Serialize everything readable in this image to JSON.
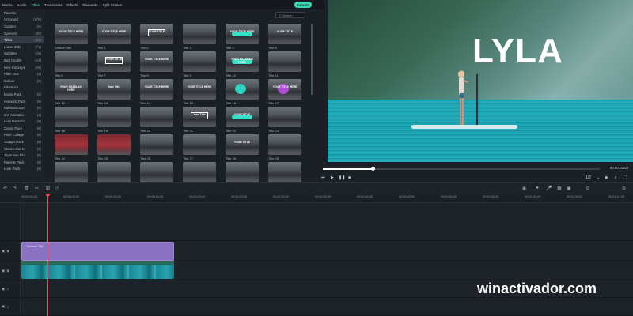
{
  "top_tabs": [
    "Media",
    "Audio",
    "Titles",
    "Transitions",
    "Effects",
    "Elements",
    "Split Screen"
  ],
  "export_label": "EXPORT",
  "search_placeholder": "Search",
  "categories": [
    {
      "label": "Favorite",
      "count": ""
    },
    {
      "label": "Unlocked",
      "count": "(176)"
    },
    {
      "label": "Custom",
      "count": "(0)"
    },
    {
      "label": "Openers",
      "count": "(30)"
    },
    {
      "label": "Titles",
      "count": "(43)"
    },
    {
      "label": "Lower 3rds",
      "count": "(71)"
    },
    {
      "label": "Subtitles",
      "count": "(15)"
    },
    {
      "label": "End Credits",
      "count": "(14)"
    },
    {
      "label": "New Concept",
      "count": "(28)"
    },
    {
      "label": "Plain Text",
      "count": "(4)"
    },
    {
      "label": "Callout",
      "count": "(8)"
    },
    {
      "label": "Filmstock",
      "count": ""
    },
    {
      "label": "Moxie Pack",
      "count": "(8)"
    },
    {
      "label": "Hypnotic Pack",
      "count": "(8)"
    },
    {
      "label": "Kaleidoscope",
      "count": "(9)"
    },
    {
      "label": "2nd Animatio",
      "count": "(4)"
    },
    {
      "label": "Hula Barmsho",
      "count": "(8)"
    },
    {
      "label": "Comic Pack",
      "count": "(8)"
    },
    {
      "label": "Pixel Collage",
      "count": "(8)"
    },
    {
      "label": "Gadget Pack",
      "count": "(8)"
    },
    {
      "label": "Sketch and C",
      "count": "(8)"
    },
    {
      "label": "Japanese Dra",
      "count": "(8)"
    },
    {
      "label": "Parents Pack",
      "count": "(8)"
    },
    {
      "label": "Love Pack",
      "count": "(8)"
    }
  ],
  "titles": [
    {
      "label": "Default Title",
      "caption": "YOUR TITLE HERE"
    },
    {
      "label": "Title 1",
      "caption": "YOUR TITLE HERE"
    },
    {
      "label": "Title 2",
      "caption": "YOUR TITLE"
    },
    {
      "label": "Title 3",
      "caption": ""
    },
    {
      "label": "Title 4",
      "caption": "YOUR TITLE HERE"
    },
    {
      "label": "Title 5",
      "caption": "YOUR TITLE"
    },
    {
      "label": "Title 6",
      "caption": ""
    },
    {
      "label": "Title 7",
      "caption": "YOUR TITLE"
    },
    {
      "label": "Title 8",
      "caption": "YOUR TITLE HERE"
    },
    {
      "label": "Title 9",
      "caption": ""
    },
    {
      "label": "Title 10",
      "caption": "YOUR HEADLINE HERE"
    },
    {
      "label": "Title 11",
      "caption": ""
    },
    {
      "label": "Title 12",
      "caption": "YOUR HEADLINE HERE"
    },
    {
      "label": "Title 13",
      "caption": "Your Title"
    },
    {
      "label": "Title 14",
      "caption": "YOUR TITLE HERE"
    },
    {
      "label": "Title 15",
      "caption": "YOUR TITLE HERE"
    },
    {
      "label": "Title 16",
      "caption": ""
    },
    {
      "label": "Title 17",
      "caption": "YOUR TITLE HERE"
    },
    {
      "label": "Title 18",
      "caption": ""
    },
    {
      "label": "Title 19",
      "caption": ""
    },
    {
      "label": "Title 20",
      "caption": ""
    },
    {
      "label": "Title 21",
      "caption": "Your Title"
    },
    {
      "label": "Title 22",
      "caption": "YOUR TITLE"
    },
    {
      "label": "Title 23",
      "caption": ""
    },
    {
      "label": "Title 24",
      "caption": ""
    },
    {
      "label": "Title 25",
      "caption": ""
    },
    {
      "label": "Title 26",
      "caption": ""
    },
    {
      "label": "Title 27",
      "caption": ""
    },
    {
      "label": "Title 28",
      "caption": "YOUR TITLE"
    },
    {
      "label": "Title 29",
      "caption": ""
    },
    {
      "label": "",
      "caption": ""
    },
    {
      "label": "",
      "caption": ""
    },
    {
      "label": "",
      "caption": ""
    },
    {
      "label": "",
      "caption": ""
    },
    {
      "label": "",
      "caption": ""
    },
    {
      "label": "",
      "caption": ""
    }
  ],
  "preview": {
    "title_text": "LYLA",
    "time": "00:00:03:04",
    "progress": 0.18,
    "zoom": "1/2"
  },
  "timeline": {
    "ticks": [
      "00:00:00:00",
      "00:00:05:00",
      "00:00:10:00",
      "00:00:15:00",
      "00:00:20:00",
      "00:00:25:00",
      "00:00:30:00",
      "00:00:35:00",
      "00:00:40:00",
      "00:00:45:00",
      "00:00:50:00",
      "00:00:55:00",
      "00:01:00:00",
      "00:01:05:00",
      "00:01:10:00"
    ],
    "title_clip": "Default Title"
  },
  "watermark": "winactivador.com",
  "colors": {
    "accent": "#3bd9b7",
    "title_clip": "#8a72c2",
    "playhead": "#ff4a55"
  }
}
